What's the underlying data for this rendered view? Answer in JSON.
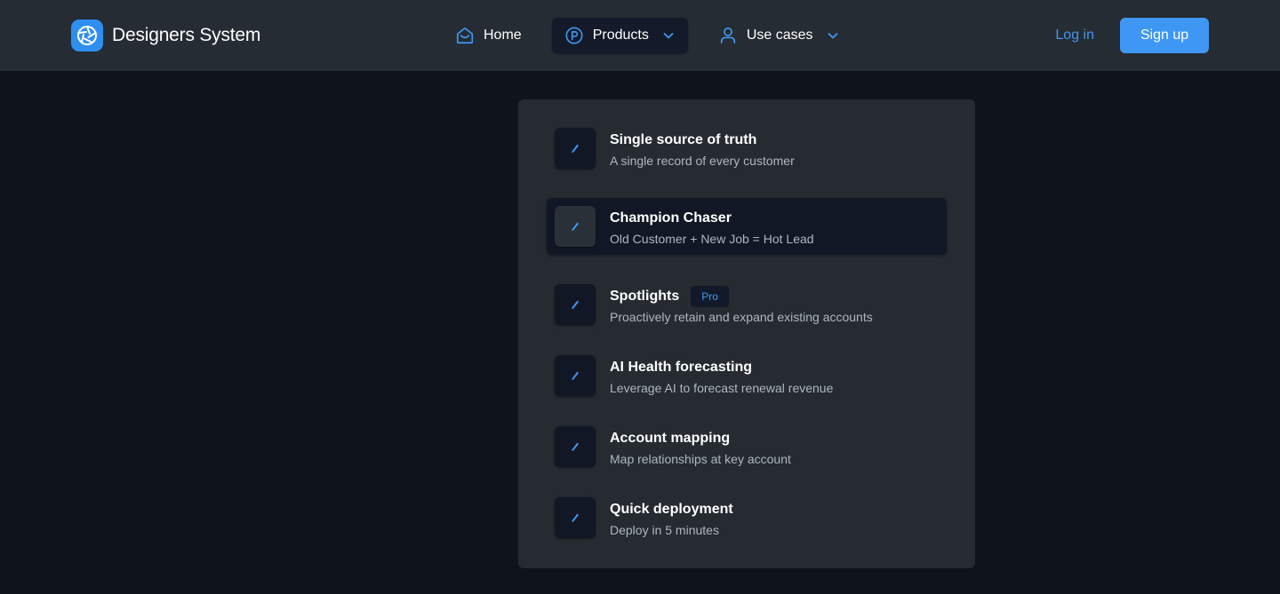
{
  "brand": {
    "name": "Designers System",
    "logo_icon": "aperture-logo-icon",
    "accent": "#2f8ff0"
  },
  "nav": {
    "items": [
      {
        "label": "Home",
        "icon": "home-icon",
        "active": false,
        "has_dropdown": false
      },
      {
        "label": "Products",
        "icon": "products-p-circle-icon",
        "active": true,
        "has_dropdown": true
      },
      {
        "label": "Use cases",
        "icon": "user-icon",
        "active": false,
        "has_dropdown": true
      }
    ]
  },
  "auth": {
    "login_label": "Log in",
    "signup_label": "Sign up"
  },
  "products_menu": {
    "items": [
      {
        "title": "Single source of truth",
        "description": "A single record of every customer",
        "icon": "pencil-icon",
        "badge": "",
        "highlighted": false
      },
      {
        "title": "Champion Chaser",
        "description": "Old Customer + New Job = Hot Lead",
        "icon": "pencil-icon",
        "badge": "",
        "highlighted": true
      },
      {
        "title": "Spotlights",
        "description": "Proactively retain and expand existing accounts",
        "icon": "pencil-icon",
        "badge": "Pro",
        "highlighted": false
      },
      {
        "title": "AI Health forecasting",
        "description": "Leverage AI to forecast renewal revenue",
        "icon": "pencil-icon",
        "badge": "",
        "highlighted": false
      },
      {
        "title": "Account mapping",
        "description": "Map relationships at key account",
        "icon": "pencil-icon",
        "badge": "",
        "highlighted": false
      },
      {
        "title": "Quick deployment",
        "description": "Deploy in 5 minutes",
        "icon": "pencil-icon",
        "badge": "",
        "highlighted": false
      }
    ]
  },
  "colors": {
    "page_bg": "#0f131b",
    "topbar_bg": "#262c33",
    "panel_bg": "#252b31",
    "accent_blue": "#3f97f4",
    "muted_text": "#aeb6c0"
  }
}
